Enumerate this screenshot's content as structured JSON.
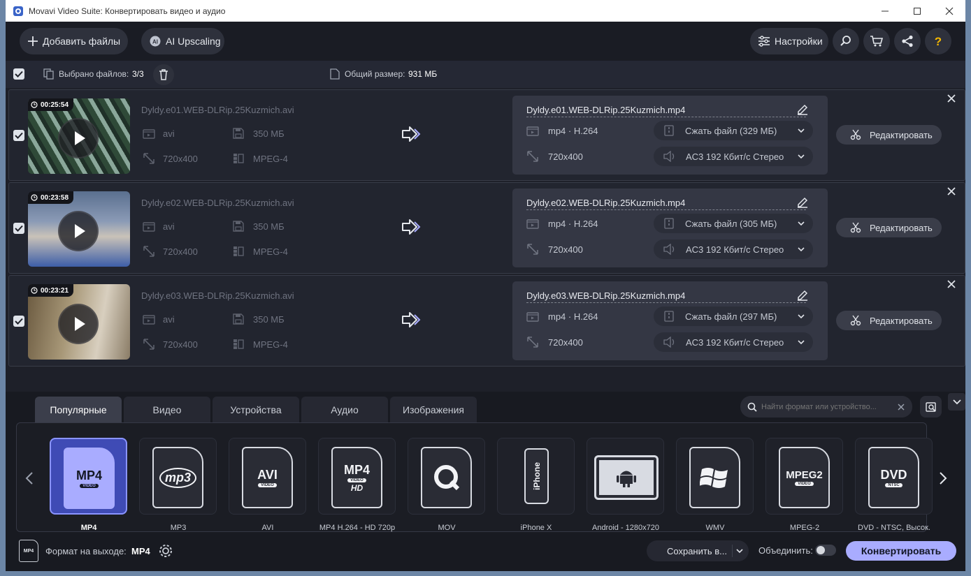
{
  "window": {
    "title": "Movavi Video Suite: Конвертировать видео и аудио"
  },
  "toolbar": {
    "add_files": "Добавить файлы",
    "ai_upscaling": "AI Upscaling",
    "settings": "Настройки"
  },
  "selection": {
    "label": "Выбрано файлов:",
    "count": "3/3",
    "total_label": "Общий размер:",
    "total_value": "931 МБ"
  },
  "files": [
    {
      "duration": "00:25:54",
      "src_name": "Dyldy.e01.WEB-DLRip.25Kuzmich.avi",
      "src_ext": "avi",
      "src_size": "350 МБ",
      "src_res": "720x400",
      "src_codec": "MPEG-4",
      "out_name": "Dyldy.e01.WEB-DLRip.25Kuzmich.mp4",
      "out_codec": "mp4 · H.264",
      "out_res": "720x400",
      "compress": "Сжать файл (329 МБ)",
      "audio": "AC3 192 Кбит/с Стерео",
      "edit": "Редактировать"
    },
    {
      "duration": "00:23:58",
      "src_name": "Dyldy.e02.WEB-DLRip.25Kuzmich.avi",
      "src_ext": "avi",
      "src_size": "350 МБ",
      "src_res": "720x400",
      "src_codec": "MPEG-4",
      "out_name": "Dyldy.e02.WEB-DLRip.25Kuzmich.mp4",
      "out_codec": "mp4 · H.264",
      "out_res": "720x400",
      "compress": "Сжать файл (305 МБ)",
      "audio": "AC3 192 Кбит/с Стерео",
      "edit": "Редактировать"
    },
    {
      "duration": "00:23:21",
      "src_name": "Dyldy.e03.WEB-DLRip.25Kuzmich.avi",
      "src_ext": "avi",
      "src_size": "350 МБ",
      "src_res": "720x400",
      "src_codec": "MPEG-4",
      "out_name": "Dyldy.e03.WEB-DLRip.25Kuzmich.mp4",
      "out_codec": "mp4 · H.264",
      "out_res": "720x400",
      "compress": "Сжать файл (297 МБ)",
      "audio": "AC3 192 Кбит/с Стерео",
      "edit": "Редактировать"
    }
  ],
  "tabs": [
    "Популярные",
    "Видео",
    "Устройства",
    "Аудио",
    "Изображения"
  ],
  "search": {
    "placeholder": "Найти формат или устройство..."
  },
  "formats": [
    {
      "label": "MP4",
      "badge": "MP4",
      "sub": "VIDEO"
    },
    {
      "label": "MP3",
      "badge": "mp3",
      "sub": ""
    },
    {
      "label": "AVI",
      "badge": "AVI",
      "sub": "VIDEO"
    },
    {
      "label": "MP4 H.264 - HD 720p",
      "badge": "MP4",
      "sub": "VIDEO",
      "sub2": "HD"
    },
    {
      "label": "MOV",
      "badge": "",
      "sub": ""
    },
    {
      "label": "iPhone X",
      "badge": "iPhone",
      "sub": ""
    },
    {
      "label": "Android - 1280x720",
      "badge": "",
      "sub": ""
    },
    {
      "label": "WMV",
      "badge": "",
      "sub": ""
    },
    {
      "label": "MPEG-2",
      "badge": "MPEG2",
      "sub": "VIDEO"
    },
    {
      "label": "DVD - NTSC, Высок.",
      "badge": "DVD",
      "sub": "NTSC"
    }
  ],
  "footer": {
    "format_label": "Формат на выходе:",
    "format_value": "MP4",
    "format_icon_text": "MP4",
    "save_to": "Сохранить в...",
    "merge_label": "Объединить:",
    "convert": "Конвертировать"
  }
}
